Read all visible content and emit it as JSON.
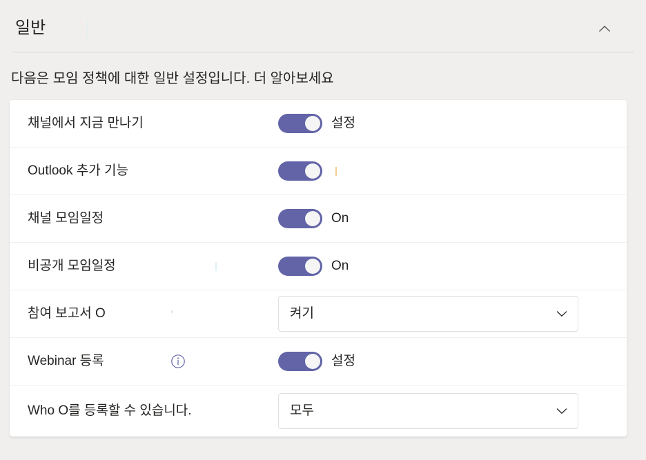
{
  "header": {
    "title": "일반",
    "collapse_icon": "chevron-up-icon",
    "collapse_label": "일반"
  },
  "description": "다음은 모임 정책에 대한 일반 설정입니다. 더 알아보세요",
  "colors": {
    "accent": "#6264A7",
    "page_background": "#F0EFED",
    "card_background": "#FFFFFF",
    "text": "#252423",
    "divider": "#D8D6D4",
    "row_divider": "#F1F0EF",
    "field_border": "#E1DFDD",
    "title_divider": "#DFF0F1",
    "faint_mark": "#E8A33D"
  },
  "settings": [
    {
      "label": "채널에서 지금 만나기",
      "control": "toggle",
      "toggle_state": "on",
      "state_text": "설정",
      "has_info": false
    },
    {
      "label": "Outlook 추가 기능",
      "control": "toggle",
      "toggle_state": "on",
      "state_text": "",
      "has_info": false
    },
    {
      "label": "채널 모임일정",
      "control": "toggle",
      "toggle_state": "on",
      "state_text": "On",
      "has_info": false
    },
    {
      "label": "비공개 모임일정",
      "control": "toggle",
      "toggle_state": "on",
      "state_text": "On",
      "has_info": false
    },
    {
      "label": "참여 보고서 O",
      "control": "dropdown",
      "value": "켜기",
      "has_info": false
    },
    {
      "label": "Webinar 등록",
      "control": "toggle",
      "toggle_state": "on",
      "state_text": "설정",
      "has_info": true,
      "info_icon": "info-icon"
    },
    {
      "label": "Who O를 등록할 수 있습니다.",
      "control": "dropdown",
      "value": "모두",
      "has_info": false
    }
  ]
}
